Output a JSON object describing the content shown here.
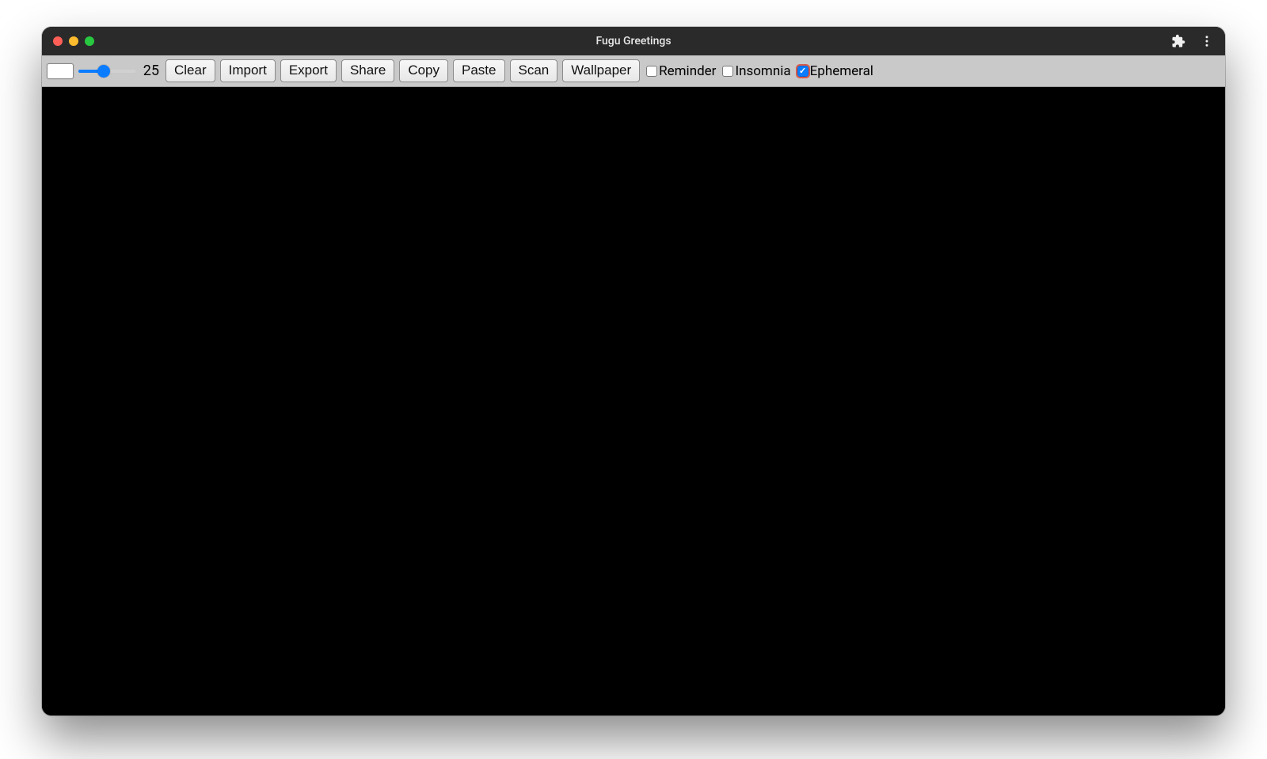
{
  "window": {
    "title": "Fugu Greetings"
  },
  "toolbar": {
    "color_swatch": "#ffffff",
    "slider_value": "25",
    "buttons": {
      "clear": "Clear",
      "import": "Import",
      "export": "Export",
      "share": "Share",
      "copy": "Copy",
      "paste": "Paste",
      "scan": "Scan",
      "wallpaper": "Wallpaper"
    },
    "checkboxes": {
      "reminder": {
        "label": "Reminder",
        "checked": false
      },
      "insomnia": {
        "label": "Insomnia",
        "checked": false
      },
      "ephemeral": {
        "label": "Ephemeral",
        "checked": true
      }
    }
  },
  "icons": {
    "extensions": "puzzle-icon",
    "more": "more-vertical-icon"
  },
  "colors": {
    "accent": "#0a7cff",
    "titlebar_bg": "#2a2a2a",
    "toolbar_bg": "#c9c9c9",
    "canvas_bg": "#000000"
  }
}
